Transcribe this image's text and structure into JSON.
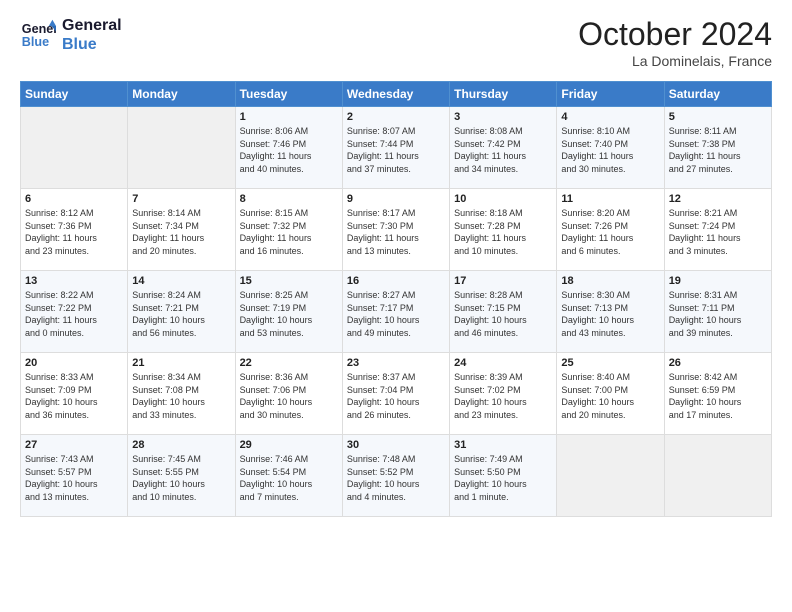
{
  "header": {
    "logo_line1": "General",
    "logo_line2": "Blue",
    "month": "October 2024",
    "location": "La Dominelais, France"
  },
  "days_of_week": [
    "Sunday",
    "Monday",
    "Tuesday",
    "Wednesday",
    "Thursday",
    "Friday",
    "Saturday"
  ],
  "weeks": [
    [
      {
        "day": "",
        "info": ""
      },
      {
        "day": "",
        "info": ""
      },
      {
        "day": "1",
        "info": "Sunrise: 8:06 AM\nSunset: 7:46 PM\nDaylight: 11 hours\nand 40 minutes."
      },
      {
        "day": "2",
        "info": "Sunrise: 8:07 AM\nSunset: 7:44 PM\nDaylight: 11 hours\nand 37 minutes."
      },
      {
        "day": "3",
        "info": "Sunrise: 8:08 AM\nSunset: 7:42 PM\nDaylight: 11 hours\nand 34 minutes."
      },
      {
        "day": "4",
        "info": "Sunrise: 8:10 AM\nSunset: 7:40 PM\nDaylight: 11 hours\nand 30 minutes."
      },
      {
        "day": "5",
        "info": "Sunrise: 8:11 AM\nSunset: 7:38 PM\nDaylight: 11 hours\nand 27 minutes."
      }
    ],
    [
      {
        "day": "6",
        "info": "Sunrise: 8:12 AM\nSunset: 7:36 PM\nDaylight: 11 hours\nand 23 minutes."
      },
      {
        "day": "7",
        "info": "Sunrise: 8:14 AM\nSunset: 7:34 PM\nDaylight: 11 hours\nand 20 minutes."
      },
      {
        "day": "8",
        "info": "Sunrise: 8:15 AM\nSunset: 7:32 PM\nDaylight: 11 hours\nand 16 minutes."
      },
      {
        "day": "9",
        "info": "Sunrise: 8:17 AM\nSunset: 7:30 PM\nDaylight: 11 hours\nand 13 minutes."
      },
      {
        "day": "10",
        "info": "Sunrise: 8:18 AM\nSunset: 7:28 PM\nDaylight: 11 hours\nand 10 minutes."
      },
      {
        "day": "11",
        "info": "Sunrise: 8:20 AM\nSunset: 7:26 PM\nDaylight: 11 hours\nand 6 minutes."
      },
      {
        "day": "12",
        "info": "Sunrise: 8:21 AM\nSunset: 7:24 PM\nDaylight: 11 hours\nand 3 minutes."
      }
    ],
    [
      {
        "day": "13",
        "info": "Sunrise: 8:22 AM\nSunset: 7:22 PM\nDaylight: 11 hours\nand 0 minutes."
      },
      {
        "day": "14",
        "info": "Sunrise: 8:24 AM\nSunset: 7:21 PM\nDaylight: 10 hours\nand 56 minutes."
      },
      {
        "day": "15",
        "info": "Sunrise: 8:25 AM\nSunset: 7:19 PM\nDaylight: 10 hours\nand 53 minutes."
      },
      {
        "day": "16",
        "info": "Sunrise: 8:27 AM\nSunset: 7:17 PM\nDaylight: 10 hours\nand 49 minutes."
      },
      {
        "day": "17",
        "info": "Sunrise: 8:28 AM\nSunset: 7:15 PM\nDaylight: 10 hours\nand 46 minutes."
      },
      {
        "day": "18",
        "info": "Sunrise: 8:30 AM\nSunset: 7:13 PM\nDaylight: 10 hours\nand 43 minutes."
      },
      {
        "day": "19",
        "info": "Sunrise: 8:31 AM\nSunset: 7:11 PM\nDaylight: 10 hours\nand 39 minutes."
      }
    ],
    [
      {
        "day": "20",
        "info": "Sunrise: 8:33 AM\nSunset: 7:09 PM\nDaylight: 10 hours\nand 36 minutes."
      },
      {
        "day": "21",
        "info": "Sunrise: 8:34 AM\nSunset: 7:08 PM\nDaylight: 10 hours\nand 33 minutes."
      },
      {
        "day": "22",
        "info": "Sunrise: 8:36 AM\nSunset: 7:06 PM\nDaylight: 10 hours\nand 30 minutes."
      },
      {
        "day": "23",
        "info": "Sunrise: 8:37 AM\nSunset: 7:04 PM\nDaylight: 10 hours\nand 26 minutes."
      },
      {
        "day": "24",
        "info": "Sunrise: 8:39 AM\nSunset: 7:02 PM\nDaylight: 10 hours\nand 23 minutes."
      },
      {
        "day": "25",
        "info": "Sunrise: 8:40 AM\nSunset: 7:00 PM\nDaylight: 10 hours\nand 20 minutes."
      },
      {
        "day": "26",
        "info": "Sunrise: 8:42 AM\nSunset: 6:59 PM\nDaylight: 10 hours\nand 17 minutes."
      }
    ],
    [
      {
        "day": "27",
        "info": "Sunrise: 7:43 AM\nSunset: 5:57 PM\nDaylight: 10 hours\nand 13 minutes."
      },
      {
        "day": "28",
        "info": "Sunrise: 7:45 AM\nSunset: 5:55 PM\nDaylight: 10 hours\nand 10 minutes."
      },
      {
        "day": "29",
        "info": "Sunrise: 7:46 AM\nSunset: 5:54 PM\nDaylight: 10 hours\nand 7 minutes."
      },
      {
        "day": "30",
        "info": "Sunrise: 7:48 AM\nSunset: 5:52 PM\nDaylight: 10 hours\nand 4 minutes."
      },
      {
        "day": "31",
        "info": "Sunrise: 7:49 AM\nSunset: 5:50 PM\nDaylight: 10 hours\nand 1 minute."
      },
      {
        "day": "",
        "info": ""
      },
      {
        "day": "",
        "info": ""
      }
    ]
  ]
}
